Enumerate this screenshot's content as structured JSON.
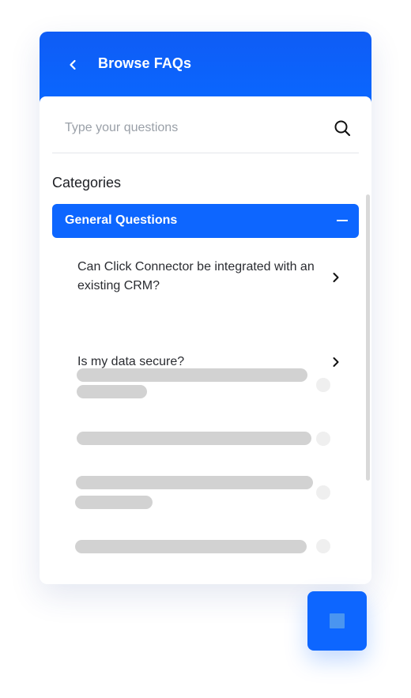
{
  "header": {
    "title": "Browse FAQs",
    "back_icon": "chevron-left-icon"
  },
  "search": {
    "placeholder": "Type your questions",
    "value": "",
    "icon": "search-icon"
  },
  "categories": {
    "title": "Categories",
    "active_category": {
      "label": "General Questions",
      "state": "expanded",
      "icon": "minus-icon"
    }
  },
  "faqs": [
    {
      "question": "Can Click Connector be integrated with an existing CRM?",
      "icon": "chevron-right-icon"
    },
    {
      "question": "Is my data secure?",
      "icon": "chevron-right-icon"
    }
  ],
  "placeholders": {
    "loading_items": 4
  },
  "launcher": {
    "icon": "stop-square-icon"
  },
  "colors": {
    "accent": "#0d66ff",
    "header_gradient_top": "#0f5cf5",
    "skeleton": "#d2d2d2",
    "text": "#2a2c31"
  }
}
